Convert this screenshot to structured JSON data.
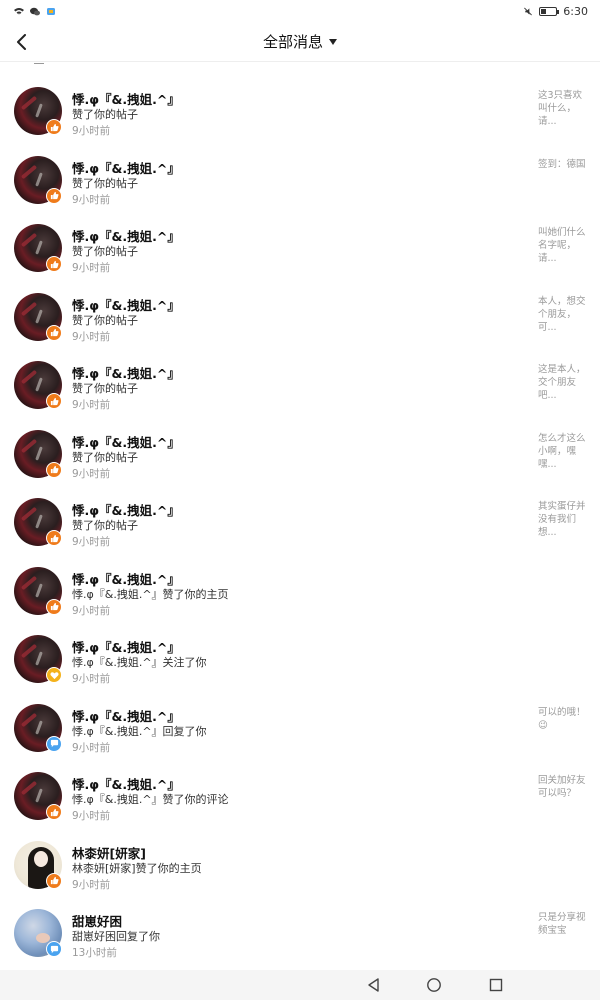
{
  "status_bar": {
    "time": "6:30"
  },
  "header": {
    "title": "全部消息"
  },
  "colors": {
    "like": "#ef7b1b",
    "follow": "#f4b21c",
    "reply": "#4aa3ef"
  },
  "messages": [
    {
      "name": "悸.φ『&.拽姐.^』",
      "action": "赞了你的帖子",
      "time": "9小时前",
      "snippet": "这3只喜欢叫什么，请...",
      "badge": "like-icon"
    },
    {
      "name": "悸.φ『&.拽姐.^』",
      "action": "赞了你的帖子",
      "time": "9小时前",
      "snippet": "签到：德国",
      "badge": "like-icon"
    },
    {
      "name": "悸.φ『&.拽姐.^』",
      "action": "赞了你的帖子",
      "time": "9小时前",
      "snippet": "叫她们什么名字呢，请...",
      "badge": "like-icon"
    },
    {
      "name": "悸.φ『&.拽姐.^』",
      "action": "赞了你的帖子",
      "time": "9小时前",
      "snippet": "本人，想交个朋友，可...",
      "badge": "like-icon"
    },
    {
      "name": "悸.φ『&.拽姐.^』",
      "action": "赞了你的帖子",
      "time": "9小时前",
      "snippet": "这是本人，交个朋友吧...",
      "badge": "like-icon"
    },
    {
      "name": "悸.φ『&.拽姐.^』",
      "action": "赞了你的帖子",
      "time": "9小时前",
      "snippet": "怎么才这么小啊，嘿嘿...",
      "badge": "like-icon"
    },
    {
      "name": "悸.φ『&.拽姐.^』",
      "action": "赞了你的帖子",
      "time": "9小时前",
      "snippet": "其实蛋仔并没有我们想...",
      "badge": "like-icon"
    },
    {
      "name": "悸.φ『&.拽姐.^』",
      "action": "悸.φ『&.拽姐.^』赞了你的主页",
      "time": "9小时前",
      "snippet": "",
      "badge": "like-icon"
    },
    {
      "name": "悸.φ『&.拽姐.^』",
      "action": "悸.φ『&.拽姐.^』关注了你",
      "time": "9小时前",
      "snippet": "",
      "badge": "follow-icon"
    },
    {
      "name": "悸.φ『&.拽姐.^』",
      "action": "悸.φ『&.拽姐.^』回复了你",
      "time": "9小时前",
      "snippet": "可以的哦！😉",
      "badge": "reply-icon"
    },
    {
      "name": "悸.φ『&.拽姐.^』",
      "action": "悸.φ『&.拽姐.^』赞了你的评论",
      "time": "9小时前",
      "snippet": "回关加好友可以吗？",
      "badge": "like-icon"
    },
    {
      "name": "林桼妍[妍家]",
      "action": "林桼妍[妍家]赞了你的主页",
      "time": "9小时前",
      "snippet": "",
      "badge": "like-icon"
    },
    {
      "name": "甜崽好困",
      "action": "甜崽好困回复了你",
      "time": "13小时前",
      "snippet": "只是分享视频宝宝",
      "badge": "reply-icon"
    }
  ]
}
